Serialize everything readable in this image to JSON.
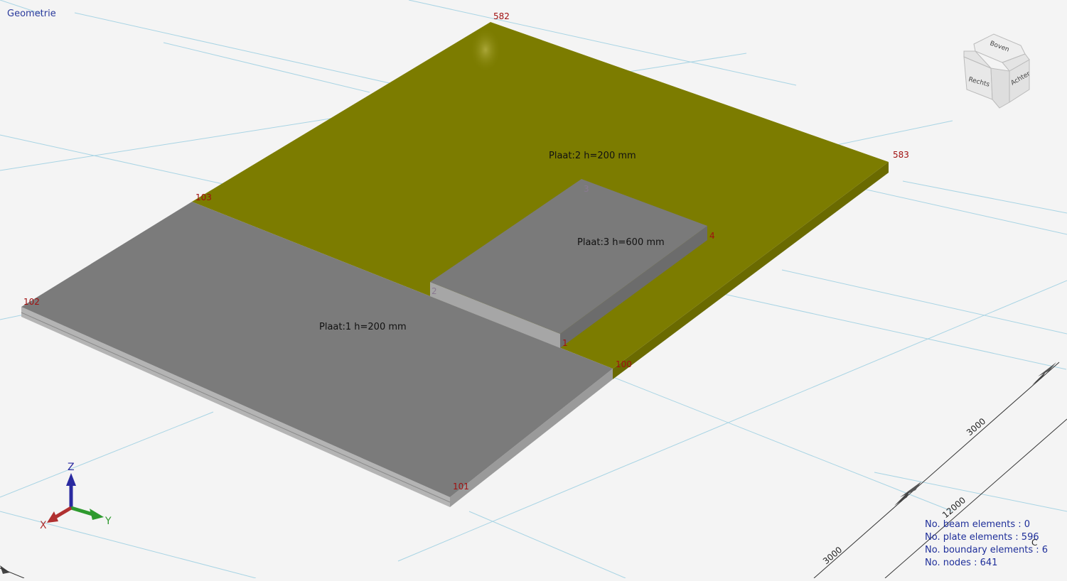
{
  "view": {
    "title": "Geometrie"
  },
  "plates": [
    {
      "label": "Plaat:1 h=200 mm",
      "color": "#7b7b7b"
    },
    {
      "label": "Plaat:2 h=200 mm",
      "color": "#7c7c00"
    },
    {
      "label": "Plaat:3 h=600 mm",
      "color": "#7a7a7a"
    }
  ],
  "nodes": {
    "n582": "582",
    "n583": "583",
    "n103": "103",
    "n102": "102",
    "n100": "100",
    "n101": "101",
    "n1": "1",
    "n2": "2",
    "n3": "3",
    "n4": "4"
  },
  "dimensions": {
    "d1": "3000",
    "d2": "12000",
    "d3": "3000",
    "d4": "C"
  },
  "axes": {
    "x": "X",
    "y": "Y",
    "z": "Z",
    "x_color": "#b03030",
    "y_color": "#2e9a2e",
    "z_color": "#2a2aa0"
  },
  "view_cube": {
    "top": "Boven",
    "right_face": "Rechts",
    "back_face": "Achter"
  },
  "stats": {
    "beam": "No. beam elements : 0",
    "plate": "No. plate elements : 596",
    "boundary": "No. boundary elements : 6",
    "nodes": "No. nodes : 641"
  }
}
